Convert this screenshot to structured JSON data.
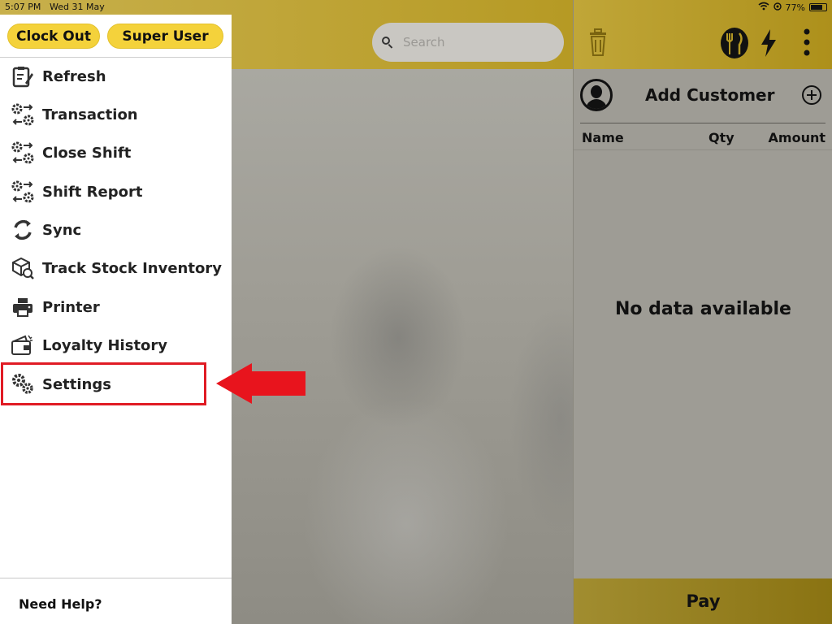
{
  "status_bar": {
    "time": "5:07 PM",
    "date": "Wed 31 May",
    "battery": "77%",
    "battery_level": 0.77
  },
  "drawer": {
    "clock_out_label": "Clock Out",
    "user_label": "Super User",
    "menu": [
      {
        "label": "Refresh",
        "icon": "clipboard-edit-icon"
      },
      {
        "label": "Transaction",
        "icon": "gears-exchange-icon"
      },
      {
        "label": "Close Shift",
        "icon": "gears-exchange-icon"
      },
      {
        "label": "Shift Report",
        "icon": "gears-exchange-icon"
      },
      {
        "label": "Sync",
        "icon": "sync-icon"
      },
      {
        "label": "Track Stock Inventory",
        "icon": "box-search-icon"
      },
      {
        "label": "Printer",
        "icon": "printer-icon"
      },
      {
        "label": "Loyalty History",
        "icon": "wallet-icon"
      },
      {
        "label": "Settings",
        "icon": "gears-icon"
      }
    ],
    "highlighted_item": "Settings",
    "footer_label": "Need Help?"
  },
  "main": {
    "search_placeholder": "Search"
  },
  "cart": {
    "add_customer_label": "Add Customer",
    "columns": [
      "Name",
      "Qty",
      "Amount"
    ],
    "empty_message": "No data available",
    "pay_label": "Pay"
  },
  "colors": {
    "accent": "#f4d23b",
    "highlight": "#e01b24",
    "header": "#b69a24"
  }
}
